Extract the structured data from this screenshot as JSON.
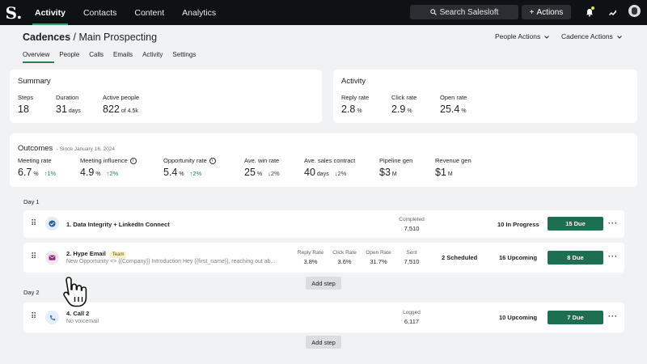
{
  "nav": {
    "logo": "S.",
    "tabs": [
      "Activity",
      "Contacts",
      "Content",
      "Analytics"
    ],
    "active_tab": "Activity",
    "search_label": "Search Salesloft",
    "actions_label": "Actions"
  },
  "header": {
    "title_bold": "Cadences",
    "title_rest": " / Main Prospecting",
    "people_actions": "People Actions",
    "cadence_actions": "Cadence Actions",
    "tabs": [
      "Overview",
      "People",
      "Calls",
      "Emails",
      "Activity",
      "Settings"
    ]
  },
  "summary": {
    "title": "Summary",
    "steps_label": "Steps",
    "steps_value": "18",
    "duration_label": "Duration",
    "duration_value": "31",
    "duration_unit": "days",
    "active_label": "Active people",
    "active_value": "822",
    "active_unit": "of 4.5k"
  },
  "activity": {
    "title": "Activity",
    "reply_label": "Reply rate",
    "reply_value": "2.8",
    "click_label": "Click rate",
    "click_value": "2.9",
    "open_label": "Open rate",
    "open_value": "25.4",
    "pct": "%"
  },
  "outcomes": {
    "title": "Outcomes",
    "since": "- Since January 16, 2024",
    "meeting_rate_label": "Meeting rate",
    "meeting_rate_value": "6.7",
    "meeting_rate_delta": "1%",
    "meeting_infl_label": "Meeting influence",
    "meeting_infl_value": "4.9",
    "meeting_infl_delta": "2%",
    "opp_label": "Opportunity rate",
    "opp_value": "5.4",
    "opp_delta": "2%",
    "win_label": "Ave. win rate",
    "win_value": "25",
    "win_delta": "2%",
    "contract_label": "Ave. sales contract",
    "contract_value": "40",
    "contract_unit": "days",
    "contract_delta": "2%",
    "pipeline_label": "Pipeline gen",
    "pipeline_value": "$3",
    "pipeline_unit": "M",
    "revenue_label": "Revenue gen",
    "revenue_value": "$1",
    "revenue_unit": "M",
    "pct": "%"
  },
  "days": [
    {
      "label": "Day 1",
      "steps": [
        {
          "title": "1. Data Integrity + LinkedIn Connect",
          "metric_label": "Completed",
          "metric_value": "7,510",
          "status": "10 In Progress",
          "due": "15 Due"
        },
        {
          "title": "2. Hype Email",
          "badge": "Team",
          "subtitle": "New Opportunity <> {{Company}} Introduction Hey {{first_name}}, reaching out ab...",
          "reply_label": "Reply Rate",
          "reply_value": "3.8%",
          "click_label": "Click Rate",
          "click_value": "3.6%",
          "open_label": "Open Rate",
          "open_value": "31.7%",
          "sent_label": "Sent",
          "sent_value": "7,510",
          "scheduled": "2 Scheduled",
          "status": "16 Upcoming",
          "due": "8 Due"
        }
      ],
      "add_step": "Add step"
    },
    {
      "label": "Day 2",
      "steps": [
        {
          "title": "4. Call 2",
          "subtitle": "No voicemail",
          "metric_label": "Logged",
          "metric_value": "6,117",
          "status": "10 Upcoming",
          "due": "7 Due"
        }
      ],
      "add_step": "Add step"
    }
  ],
  "colors": {
    "nav_bg": "#0f1215",
    "accent_green": "#1e6e52",
    "page_bg": "#f1f2f3"
  }
}
